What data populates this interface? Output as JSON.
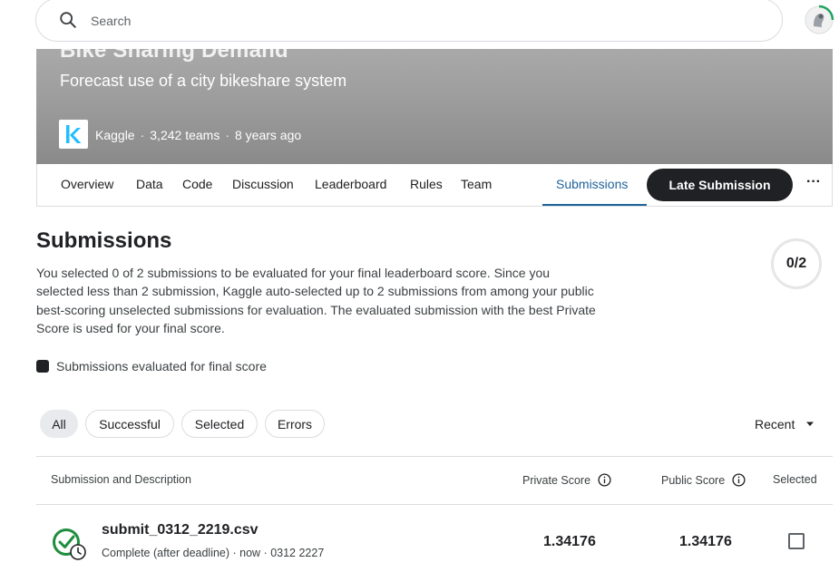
{
  "search": {
    "placeholder": "Search",
    "value": ""
  },
  "competition": {
    "title": "Bike Sharing Demand",
    "subtitle": "Forecast use of a city bikeshare system",
    "host": "Kaggle",
    "teams": "3,242 teams",
    "age": "8 years ago",
    "separator": "·"
  },
  "tabs": [
    {
      "label": "Overview"
    },
    {
      "label": "Data"
    },
    {
      "label": "Code"
    },
    {
      "label": "Discussion"
    },
    {
      "label": "Leaderboard"
    },
    {
      "label": "Rules"
    },
    {
      "label": "Team"
    },
    {
      "label": "Submissions",
      "active": true
    }
  ],
  "actions": {
    "late_submission": "Late Submission",
    "more": "···"
  },
  "submissions": {
    "heading": "Submissions",
    "description": "You selected 0 of 2 submissions to be evaluated for your final leaderboard score. Since you selected less than 2 submission, Kaggle auto-selected up to 2 submissions from among your public best-scoring unselected submissions for evaluation. The evaluated submission with the best Private Score is used for your final score.",
    "selected_count": "0/2",
    "legend": "Submissions evaluated for final score"
  },
  "filters": [
    "All",
    "Successful",
    "Selected",
    "Errors"
  ],
  "sort": {
    "label": "Recent"
  },
  "table": {
    "columns": {
      "submission": "Submission and Description",
      "private": "Private Score",
      "public": "Public Score",
      "selected": "Selected"
    },
    "rows": [
      {
        "name": "submit_0312_2219.csv",
        "meta": "Complete (after deadline) · now · 0312 2227",
        "private_score": "1.34176",
        "public_score": "1.34176",
        "selected": false
      }
    ]
  },
  "colors": {
    "accent": "#20639b",
    "success": "#1e8e3e",
    "dark": "#202124",
    "kaggle_blue": "#20beff"
  }
}
